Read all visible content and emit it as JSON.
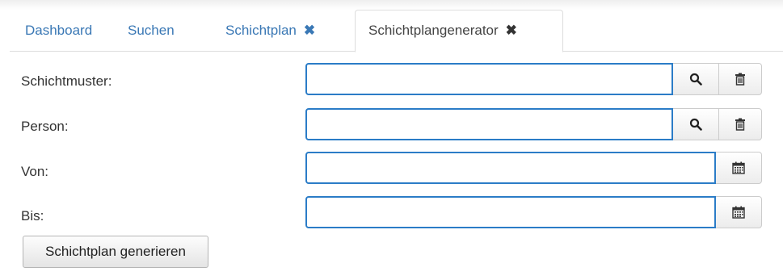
{
  "tabs": {
    "dashboard": "Dashboard",
    "suchen": "Suchen",
    "schichtplan": "Schichtplan",
    "schichtplangenerator": "Schichtplangenerator",
    "close_glyph": "✖"
  },
  "form": {
    "schichtmuster_label": "Schichtmuster:",
    "schichtmuster_value": "",
    "person_label": "Person:",
    "person_value": "",
    "von_label": "Von:",
    "von_value": "",
    "bis_label": "Bis:",
    "bis_value": "",
    "generate_button": "Schichtplan generieren"
  },
  "icons": {
    "search": "search-icon",
    "trash": "trash-icon",
    "calendar": "calendar-icon"
  },
  "colors": {
    "link": "#3a78b5",
    "focus_border": "#2b7cc7",
    "text": "#333333"
  }
}
